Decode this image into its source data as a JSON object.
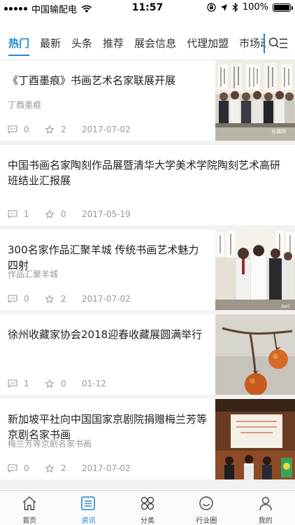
{
  "status_bar": {
    "carrier": "中国输配电",
    "time": "11:57",
    "battery": "100%"
  },
  "tabs": [
    {
      "label": "热门",
      "active": true
    },
    {
      "label": "最新"
    },
    {
      "label": "头条"
    },
    {
      "label": "推荐"
    },
    {
      "label": "展会信息"
    },
    {
      "label": "代理加盟"
    },
    {
      "label": "市场动"
    }
  ],
  "articles": [
    {
      "title": "《丁酉墨痕》书画艺术名家联展开展",
      "subtitle": "丁酉墨痕",
      "comments": "0",
      "favorites": "2",
      "date": "2017-07-02",
      "thumbnail": "group-photo-calligraphy",
      "watermark": "长城网"
    },
    {
      "title": "中国书画名家陶刻作品展暨清华大学美术学院陶刻艺术高研班结业汇报展",
      "subtitle": "",
      "comments": "1",
      "favorites": "0",
      "date": "2017-05-19",
      "thumbnail": ""
    },
    {
      "title": "300名家作品汇聚羊城 传统书画艺术魅力四射",
      "subtitle": "作品汇聚羊城",
      "comments": "0",
      "favorites": "2",
      "date": "2017-07-02",
      "thumbnail": "exhibition-visitors"
    },
    {
      "title": "徐州收藏家协会2018迎春收藏展圆满举行",
      "subtitle": "",
      "comments": "1",
      "favorites": "0",
      "date": "01-12",
      "thumbnail": "persimmon-branch"
    },
    {
      "title": "新加坡平社向中国国家京剧院捐赠梅兰芳等京剧名家书画",
      "subtitle": "梅兰芳等京剧名家书画",
      "comments": "0",
      "favorites": "2",
      "date": "2017-07-02",
      "thumbnail": "donation-ceremony"
    }
  ],
  "tabbar": [
    {
      "label": "首页",
      "icon": "home-icon"
    },
    {
      "label": "资讯",
      "icon": "news-icon",
      "active": true
    },
    {
      "label": "分类",
      "icon": "category-icon"
    },
    {
      "label": "行业圈",
      "icon": "circle-icon"
    },
    {
      "label": "我的",
      "icon": "profile-icon"
    }
  ],
  "colors": {
    "accent": "#1e88d8",
    "secondary_text": "#999999",
    "separator": "#f2f2f2"
  }
}
